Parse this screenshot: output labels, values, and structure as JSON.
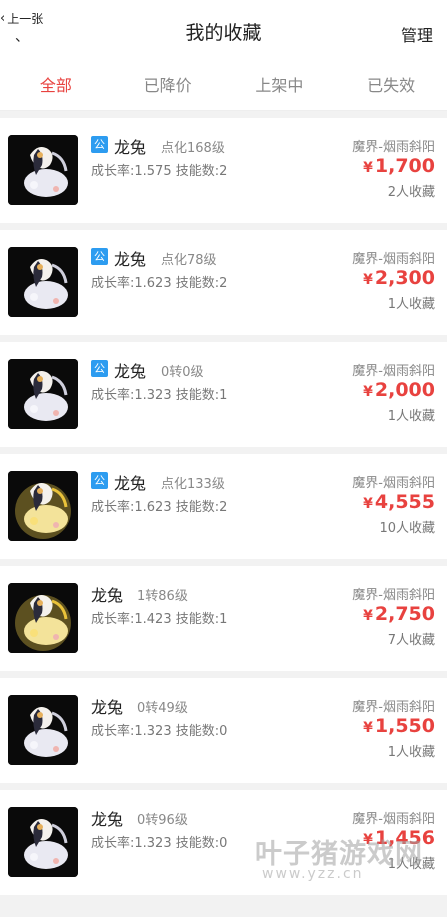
{
  "header": {
    "back_label": "上一张",
    "title": "我的收藏",
    "manage_label": "管理"
  },
  "tabs": [
    {
      "label": "全部",
      "active": true
    },
    {
      "label": "已降价",
      "active": false
    },
    {
      "label": "上架中",
      "active": false
    },
    {
      "label": "已失效",
      "active": false
    }
  ],
  "colors": {
    "accent": "#e8423f",
    "badge": "#2d9cf0"
  },
  "items": [
    {
      "badge": "公",
      "name": "龙兔",
      "level": "点化168级",
      "stats": "成长率:1.575 技能数:2",
      "server": "魔界-烟雨斜阳",
      "currency": "¥",
      "price": "1,700",
      "favs": "2人收藏",
      "image": "dragon-rabbit-pet-silver"
    },
    {
      "badge": "公",
      "name": "龙兔",
      "level": "点化78级",
      "stats": "成长率:1.623 技能数:2",
      "server": "魔界-烟雨斜阳",
      "currency": "¥",
      "price": "2,300",
      "favs": "1人收藏",
      "image": "dragon-rabbit-pet-silver"
    },
    {
      "badge": "公",
      "name": "龙兔",
      "level": "0转0级",
      "stats": "成长率:1.323 技能数:1",
      "server": "魔界-烟雨斜阳",
      "currency": "¥",
      "price": "2,000",
      "favs": "1人收藏",
      "image": "dragon-rabbit-pet-silver"
    },
    {
      "badge": "公",
      "name": "龙兔",
      "level": "点化133级",
      "stats": "成长率:1.623 技能数:2",
      "server": "魔界-烟雨斜阳",
      "currency": "¥",
      "price": "4,555",
      "favs": "10人收藏",
      "image": "dragon-rabbit-pet-gold"
    },
    {
      "badge": "",
      "name": "龙兔",
      "level": "1转86级",
      "stats": "成长率:1.423 技能数:1",
      "server": "魔界-烟雨斜阳",
      "currency": "¥",
      "price": "2,750",
      "favs": "7人收藏",
      "image": "dragon-rabbit-pet-gold"
    },
    {
      "badge": "",
      "name": "龙兔",
      "level": "0转49级",
      "stats": "成长率:1.323 技能数:0",
      "server": "魔界-烟雨斜阳",
      "currency": "¥",
      "price": "1,550",
      "favs": "1人收藏",
      "image": "dragon-rabbit-pet-silver"
    },
    {
      "badge": "",
      "name": "龙兔",
      "level": "0转96级",
      "stats": "成长率:1.323 技能数:0",
      "server": "魔界-烟雨斜阳",
      "currency": "¥",
      "price": "1,456",
      "favs": "1人收藏",
      "image": "dragon-rabbit-pet-silver"
    }
  ],
  "watermark": {
    "text": "叶子猪游戏网",
    "url": "www.yzz.cn"
  }
}
